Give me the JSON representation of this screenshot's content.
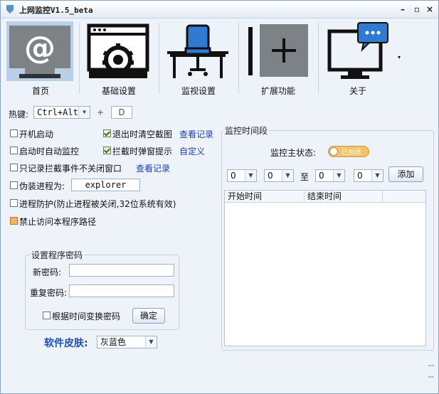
{
  "window": {
    "title": "上网监控V1.5_beta",
    "buttons": [
      "–",
      "▫",
      "×"
    ]
  },
  "toolbar": [
    {
      "label": "首页",
      "icon": "at-monitor-icon",
      "selected": true
    },
    {
      "label": "基础设置",
      "icon": "gear-window-icon",
      "selected": false
    },
    {
      "label": "监视设置",
      "icon": "office-chair-icon",
      "selected": false
    },
    {
      "label": "扩展功能",
      "icon": "plus-box-icon",
      "selected": false
    },
    {
      "label": "关于",
      "icon": "monitor-chat-icon",
      "selected": false
    }
  ],
  "hotkey": {
    "label": "热键:",
    "modifier": "Ctrl+Alt",
    "plus": "+",
    "key": "D"
  },
  "options": {
    "autostart": {
      "label": "开机启动",
      "checked": false
    },
    "autostart_monitor": {
      "label": "启动时自动监控",
      "checked": false
    },
    "record_only": {
      "label": "只记录拦截事件不关闭窗口",
      "checked": false
    },
    "fake_process": {
      "label": "伪装进程为:",
      "checked": false,
      "value": "explorer"
    },
    "process_protect": {
      "label": "进程防护(防止进程被关闭,32位系统有效)",
      "checked": false
    },
    "block_path": {
      "label": "禁止访问本程序路径",
      "checked": true
    },
    "clear_screenshots": {
      "label": "退出时清空截图",
      "checked": true
    },
    "block_popup": {
      "label": "拦截时弹窗提示",
      "checked": true
    }
  },
  "links": {
    "view_records_1": "查看记录",
    "customize": "自定义",
    "view_records_2": "查看记录"
  },
  "password": {
    "title": "设置程序密码",
    "new_label": "新密码:",
    "repeat_label": "重复密码:",
    "new_value": "",
    "repeat_value": "",
    "time_change": {
      "label": "根据时间变换密码",
      "checked": false
    },
    "confirm": "确定"
  },
  "skin": {
    "label": "软件皮肤:",
    "value": "灰蓝色"
  },
  "monitor_period": {
    "title": "监控时间段",
    "status_label": "监控主状态:",
    "status_value": "已关闭",
    "time1": "0",
    "time2": "0",
    "to": "至",
    "time3": "0",
    "time4": "0",
    "add": "添加",
    "columns": [
      "开始时间",
      "结束时间"
    ],
    "rows": []
  },
  "colors": {
    "accent": "#1c4fb5",
    "link": "#1a3fb0",
    "toggle": "#f1c46a",
    "selected_tool": "#b8cfe7"
  }
}
